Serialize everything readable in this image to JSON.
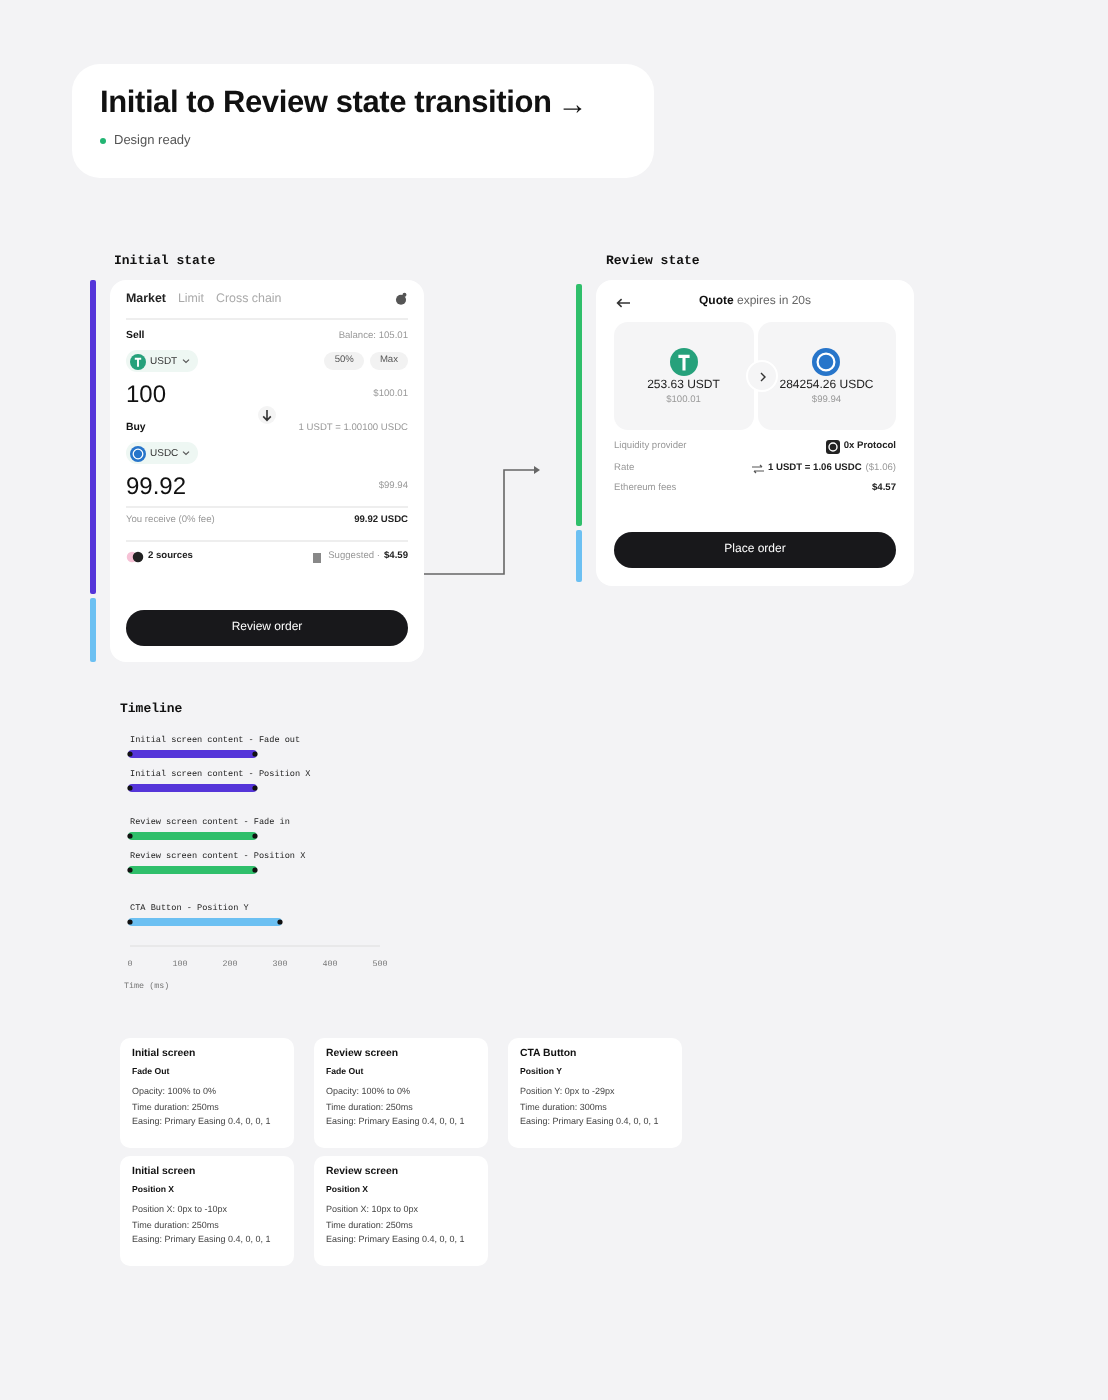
{
  "header": {
    "title": "Initial to Review state transition",
    "arrow": "→",
    "status": {
      "label": "Design ready",
      "color": "#22b573"
    }
  },
  "initial_state": {
    "label": "Initial state",
    "tabs": [
      {
        "label": "Market",
        "selected": true
      },
      {
        "label": "Limit",
        "selected": false
      },
      {
        "label": "Cross chain",
        "selected": false
      }
    ],
    "sell": {
      "label": "Sell",
      "balance": "Balance: 105.01",
      "token": "USDT",
      "chips": [
        "50%",
        "Max"
      ],
      "amount": "100",
      "usd": "$100.01"
    },
    "buy": {
      "label": "Buy",
      "rate": "1 USDT = 1.00100 USDC",
      "token": "USDC",
      "amount": "99.92",
      "usd": "$99.94"
    },
    "receive": {
      "label": "You receive (0% fee)",
      "value": "99.92 USDC"
    },
    "sources": "2 sources",
    "suggested": {
      "label": "Suggested ·",
      "value": "$4.59"
    },
    "button": "Review order"
  },
  "review_state": {
    "label": "Review state",
    "quote": "**Quote** expires in 20s",
    "from": {
      "amount": "253.63 USDT",
      "usd": "$100.01"
    },
    "to": {
      "amount": "284254.26 USDC",
      "usd": "$99.94"
    },
    "details": [
      {
        "kind": "provider",
        "label": "Liquidity provider",
        "value": "0x Protocol"
      },
      {
        "kind": "rate",
        "label": "Rate",
        "value": "1 USDT = 1.06 USDC",
        "note": "($1.06)"
      },
      {
        "kind": "plain",
        "label": "Ethereum fees",
        "value": "$4.57"
      }
    ],
    "button": "Place order"
  },
  "timeline": {
    "title": "Timeline",
    "chart_data": {
      "type": "bar",
      "orientation": "horizontal",
      "xlabel": "Time (ms)",
      "categories": [
        "Initial screen content - Fade out",
        "Initial screen content  - Position X",
        "Review screen content - Fade in",
        "Review screen content - Position X",
        "CTA Button - Position Y"
      ],
      "values": [
        250,
        250,
        250,
        250,
        300
      ],
      "xlim": [
        0,
        500
      ],
      "xticks": [
        0,
        100,
        200,
        300,
        400,
        500
      ]
    },
    "tracks": [
      {
        "color": "#5535d9"
      },
      {
        "color": "#5535d9"
      },
      {
        "color": "#2fbf6b"
      },
      {
        "color": "#2fbf6b"
      },
      {
        "color": "#6cc0f2"
      }
    ]
  },
  "specs": [
    {
      "title": "Initial screen",
      "subtitle": "Fade Out",
      "lines": [
        "Opacity: 100% to 0%",
        "Time duration: 250ms",
        "Easing: Primary Easing 0.4, 0, 0, 1"
      ]
    },
    {
      "title": "Review screen",
      "subtitle": "Fade Out",
      "lines": [
        "Opacity: 100% to 0%",
        "Time duration: 250ms",
        "Easing: Primary Easing 0.4, 0, 0, 1"
      ]
    },
    {
      "title": "CTA Button",
      "subtitle": "Position Y",
      "lines": [
        "Position Y: 0px to -29px",
        "Time duration: 300ms",
        "Easing: Primary Easing 0.4, 0, 0, 1"
      ]
    },
    {
      "title": "Initial screen",
      "subtitle": "Position X",
      "lines": [
        "Position X: 0px to -10px",
        "Time duration: 250ms",
        "Easing: Primary Easing 0.4, 0, 0, 1"
      ]
    },
    {
      "title": "Review screen",
      "subtitle": "Position X",
      "lines": [
        "Position X: 10px to 0px",
        "Time duration: 250ms",
        "Easing: Primary Easing 0.4, 0, 0, 1"
      ]
    }
  ]
}
